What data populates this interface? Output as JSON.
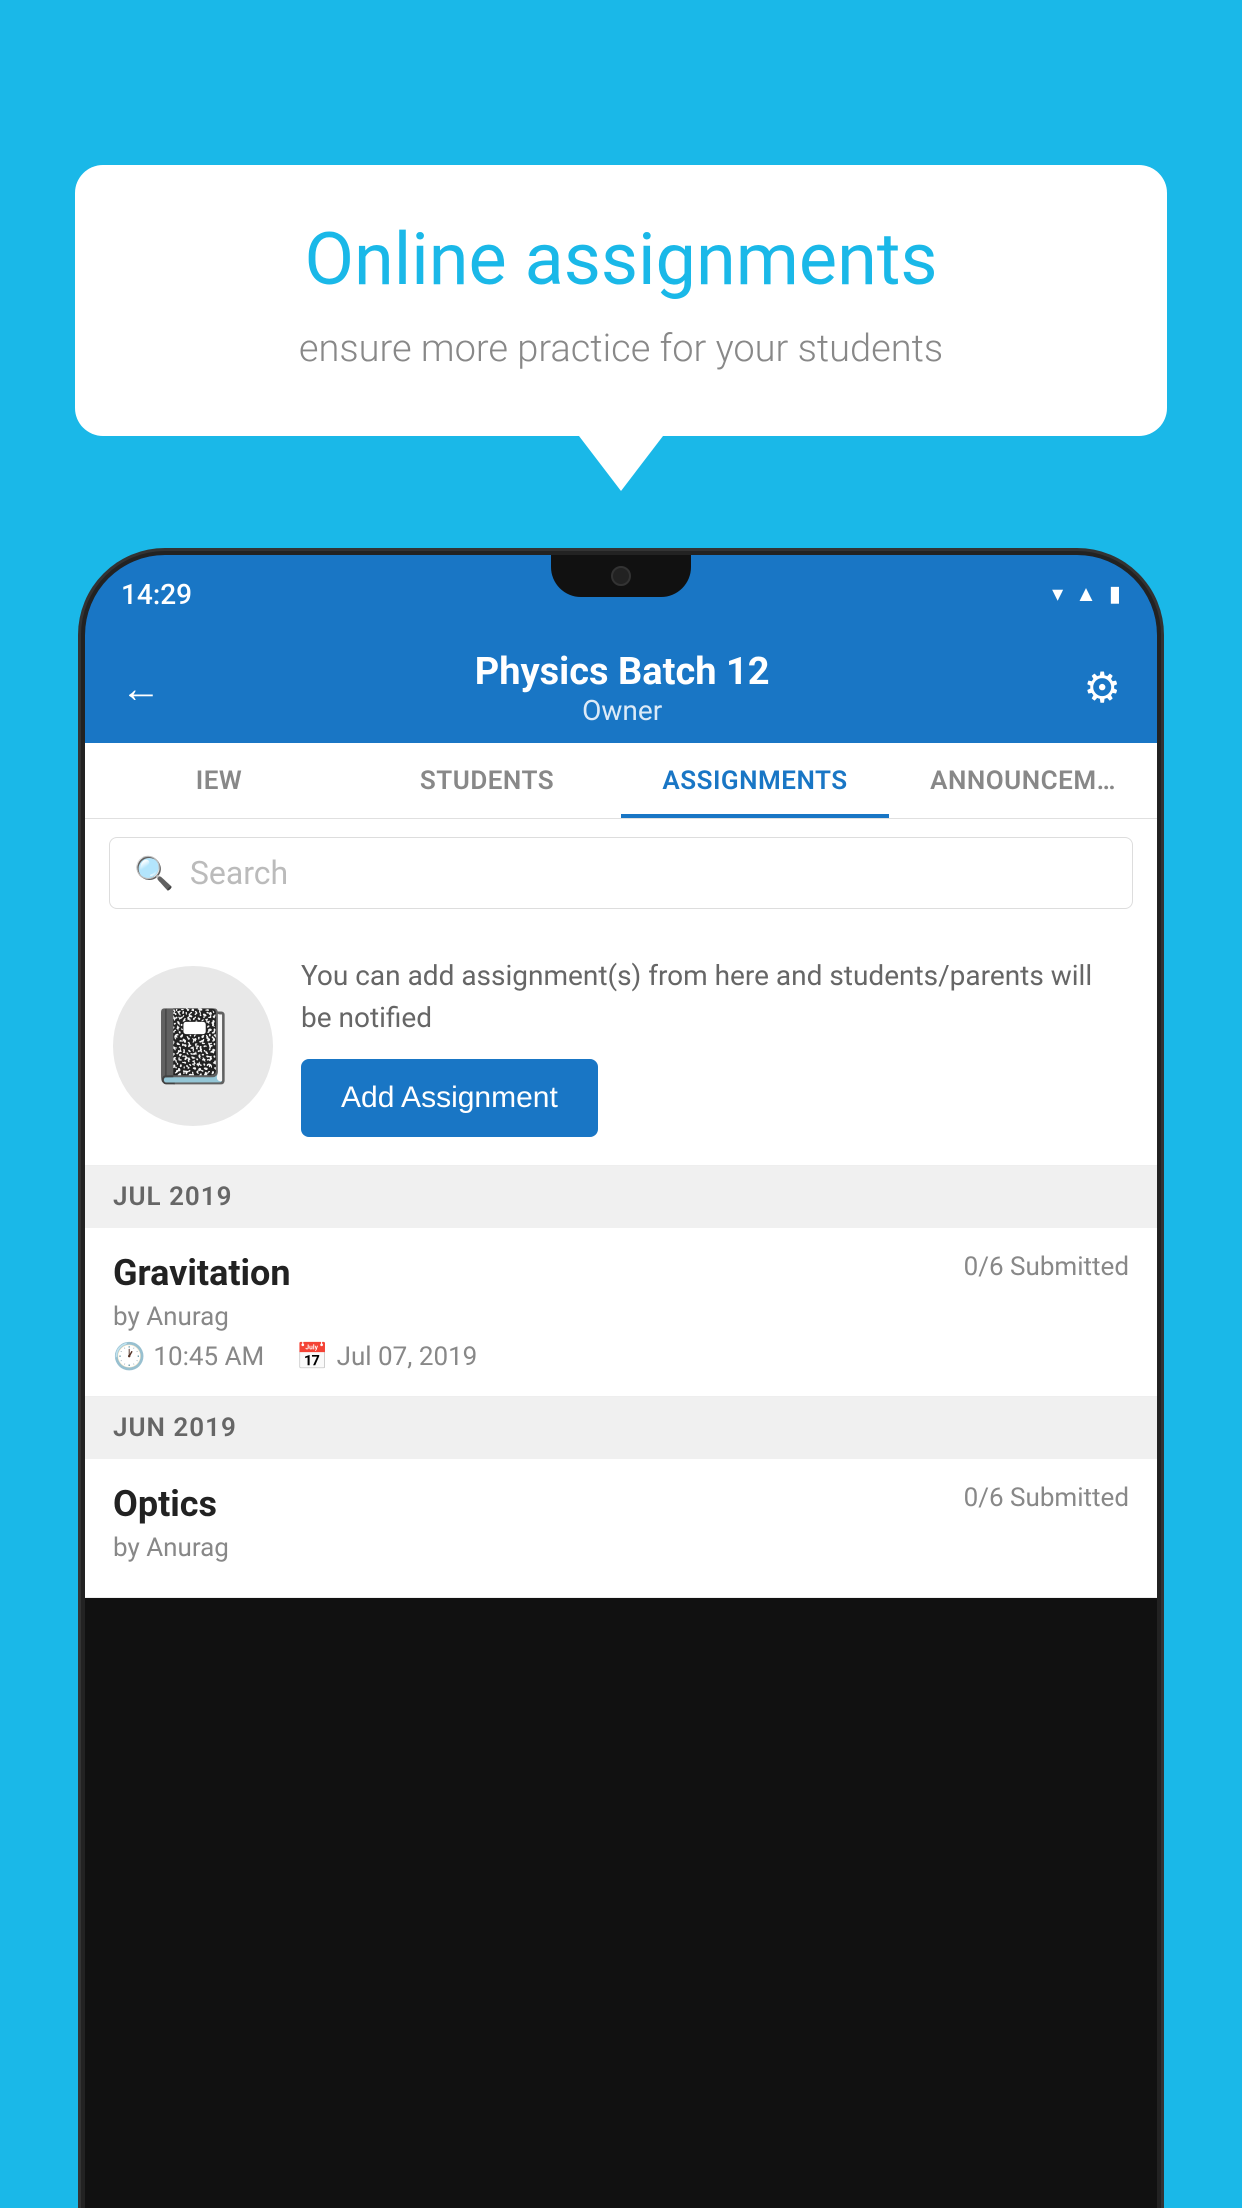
{
  "background_color": "#1ab8e8",
  "speech_bubble": {
    "heading": "Online assignments",
    "subtext": "ensure more practice for your students"
  },
  "phone": {
    "status_bar": {
      "time": "14:29",
      "icons": [
        "wifi",
        "signal",
        "battery"
      ]
    },
    "header": {
      "title": "Physics Batch 12",
      "subtitle": "Owner"
    },
    "tabs": [
      {
        "label": "IEW",
        "active": false
      },
      {
        "label": "STUDENTS",
        "active": false
      },
      {
        "label": "ASSIGNMENTS",
        "active": true
      },
      {
        "label": "ANNOUNCEM…",
        "active": false
      }
    ],
    "search": {
      "placeholder": "Search"
    },
    "promo": {
      "description": "You can add assignment(s) from here and students/parents will be notified",
      "button_label": "Add Assignment"
    },
    "sections": [
      {
        "month": "JUL 2019",
        "assignments": [
          {
            "title": "Gravitation",
            "submitted": "0/6 Submitted",
            "by": "by Anurag",
            "time": "10:45 AM",
            "date": "Jul 07, 2019"
          }
        ]
      },
      {
        "month": "JUN 2019",
        "assignments": [
          {
            "title": "Optics",
            "submitted": "0/6 Submitted",
            "by": "by Anurag",
            "time": "",
            "date": ""
          }
        ]
      }
    ]
  }
}
